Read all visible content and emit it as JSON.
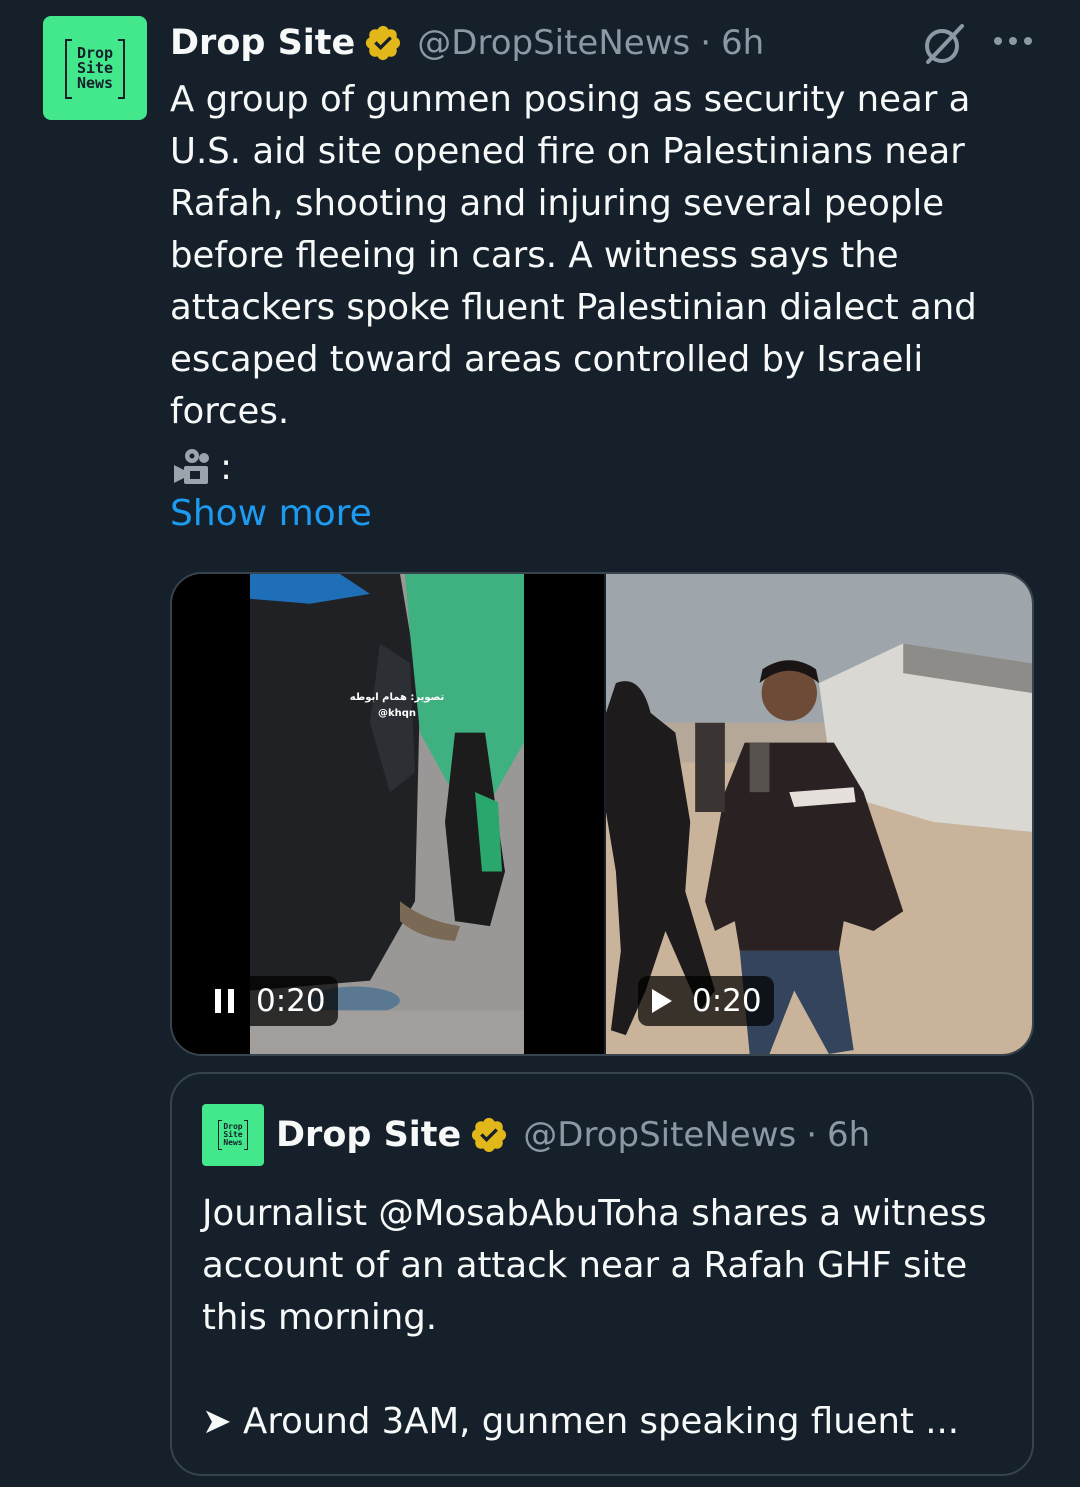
{
  "tweet": {
    "avatar_text": [
      "Drop",
      "Site",
      "News"
    ],
    "display_name": "Drop Site",
    "handle": "@DropSiteNews",
    "separator": "·",
    "time": "6h",
    "text": "A group of gunmen posing as security near a U.S. aid site opened fire on Palestinians near Rafah, shooting and injuring several people before fleeing in cars. A witness says the attackers spoke fluent Palestinian dialect and escaped toward areas controlled by Israeli forces.",
    "camera_suffix": ":",
    "show_more": "Show more"
  },
  "media": {
    "video1": {
      "overlay_caption": "تصوير: همام ابوطه",
      "overlay_handle": "@khqn",
      "duration": "0:20",
      "state": "playing"
    },
    "video2": {
      "duration": "0:20",
      "state": "paused"
    }
  },
  "quote": {
    "avatar_text": [
      "Drop",
      "Site",
      "News"
    ],
    "display_name": "Drop Site",
    "handle": "@DropSiteNews",
    "separator": "·",
    "time": "6h",
    "text": "Journalist @MosabAbuToha shares a witness account of an attack near a Rafah GHF site this morning.",
    "text2": "➤ Around 3AM, gunmen speaking fluent ..."
  },
  "colors": {
    "background": "#15202b",
    "accent": "#1d9bf0",
    "verified_gold": "#e2b719",
    "brand_green": "#43e88d",
    "secondary_text": "#8b98a5"
  },
  "icons": [
    "verified-badge-icon",
    "grok-icon",
    "more-icon",
    "camera-icon",
    "pause-icon",
    "play-icon"
  ]
}
